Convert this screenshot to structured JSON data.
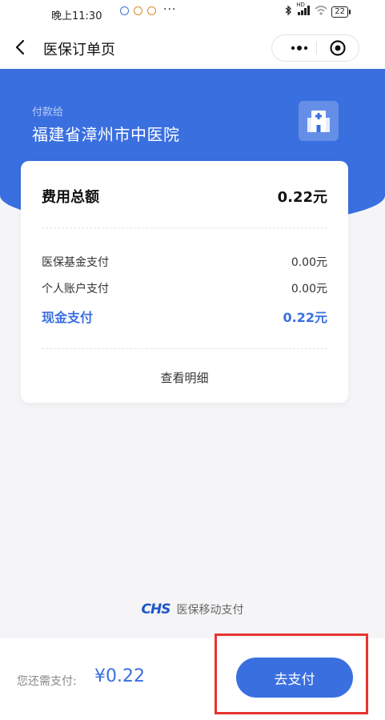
{
  "status_bar": {
    "time": "晚上11:30",
    "dots": "···",
    "network": "HD",
    "battery": "22"
  },
  "nav": {
    "title": "医保订单页"
  },
  "header": {
    "pay_to_label": "付款给",
    "hospital_name": "福建省漳州市中医院"
  },
  "summary": {
    "total_label": "费用总额",
    "total_value": "0.22元",
    "rows": [
      {
        "label": "医保基金支付",
        "value": "0.00元"
      },
      {
        "label": "个人账户支付",
        "value": "0.00元"
      },
      {
        "label": "现金支付",
        "value": "0.22元"
      }
    ],
    "detail_link": "查看明细"
  },
  "brand": {
    "logo_text": "CHS",
    "text": "医保移动支付"
  },
  "footer": {
    "need_pay_label": "您还需支付:",
    "need_pay_amount": "¥0.22",
    "pay_button": "去支付"
  },
  "colors": {
    "primary": "#3a6fe0",
    "highlight_box": "#e8342f"
  }
}
